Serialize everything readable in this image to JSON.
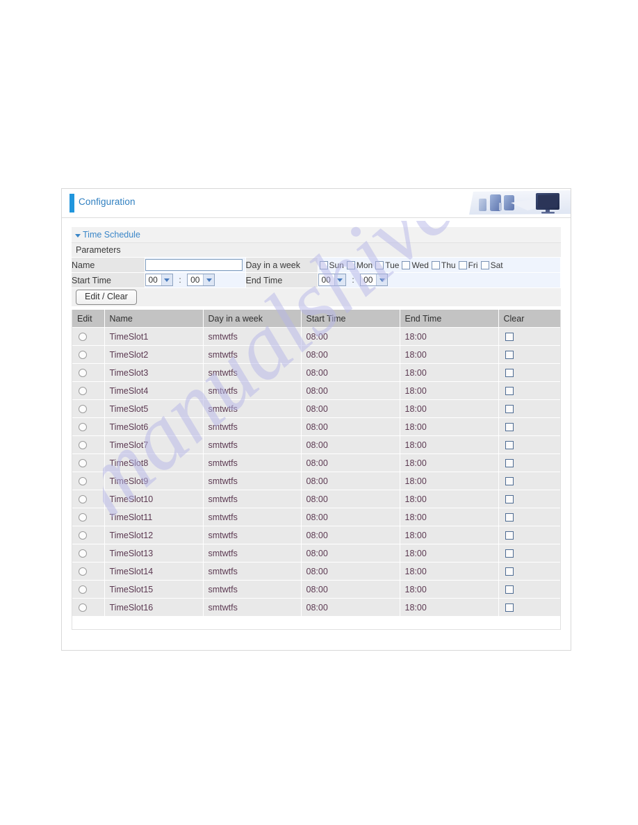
{
  "banner": {
    "title": "Configuration",
    "accent_color": "#2196dd",
    "title_color": "#2f7fc0",
    "art": "office-desk-photo"
  },
  "section": {
    "title": "Time Schedule",
    "expanded": true,
    "marker_color": "#3a86c8"
  },
  "params": {
    "heading": "Parameters",
    "name_label": "Name",
    "name_value": "",
    "name_placeholder": "",
    "day_label": "Day in a week",
    "days": [
      {
        "label": "Sun",
        "checked": false
      },
      {
        "label": "Mon",
        "checked": false
      },
      {
        "label": "Tue",
        "checked": false
      },
      {
        "label": "Wed",
        "checked": false
      },
      {
        "label": "Thu",
        "checked": false
      },
      {
        "label": "Fri",
        "checked": false
      },
      {
        "label": "Sat",
        "checked": false
      }
    ],
    "start_label": "Start Time",
    "start_hour": "00",
    "start_minute": "00",
    "end_label": "End Time",
    "end_hour": "00",
    "end_minute": "00",
    "time_separator": ":",
    "edit_clear_label": "Edit / Clear"
  },
  "table": {
    "columns": [
      "Edit",
      "Name",
      "Day in a week",
      "Start Time",
      "End Time",
      "Clear"
    ],
    "rows": [
      {
        "name": "TimeSlot1",
        "days": "smtwtfs",
        "start": "08:00",
        "end": "18:00",
        "selected": false,
        "clear": false
      },
      {
        "name": "TimeSlot2",
        "days": "smtwtfs",
        "start": "08:00",
        "end": "18:00",
        "selected": false,
        "clear": false
      },
      {
        "name": "TimeSlot3",
        "days": "smtwtfs",
        "start": "08:00",
        "end": "18:00",
        "selected": false,
        "clear": false
      },
      {
        "name": "TimeSlot4",
        "days": "smtwtfs",
        "start": "08:00",
        "end": "18:00",
        "selected": false,
        "clear": false
      },
      {
        "name": "TimeSlot5",
        "days": "smtwtfs",
        "start": "08:00",
        "end": "18:00",
        "selected": false,
        "clear": false
      },
      {
        "name": "TimeSlot6",
        "days": "smtwtfs",
        "start": "08:00",
        "end": "18:00",
        "selected": false,
        "clear": false
      },
      {
        "name": "TimeSlot7",
        "days": "smtwtfs",
        "start": "08:00",
        "end": "18:00",
        "selected": false,
        "clear": false
      },
      {
        "name": "TimeSlot8",
        "days": "smtwtfs",
        "start": "08:00",
        "end": "18:00",
        "selected": false,
        "clear": false
      },
      {
        "name": "TimeSlot9",
        "days": "smtwtfs",
        "start": "08:00",
        "end": "18:00",
        "selected": false,
        "clear": false
      },
      {
        "name": "TimeSlot10",
        "days": "smtwtfs",
        "start": "08:00",
        "end": "18:00",
        "selected": false,
        "clear": false
      },
      {
        "name": "TimeSlot11",
        "days": "smtwtfs",
        "start": "08:00",
        "end": "18:00",
        "selected": false,
        "clear": false
      },
      {
        "name": "TimeSlot12",
        "days": "smtwtfs",
        "start": "08:00",
        "end": "18:00",
        "selected": false,
        "clear": false
      },
      {
        "name": "TimeSlot13",
        "days": "smtwtfs",
        "start": "08:00",
        "end": "18:00",
        "selected": false,
        "clear": false
      },
      {
        "name": "TimeSlot14",
        "days": "smtwtfs",
        "start": "08:00",
        "end": "18:00",
        "selected": false,
        "clear": false
      },
      {
        "name": "TimeSlot15",
        "days": "smtwtfs",
        "start": "08:00",
        "end": "18:00",
        "selected": false,
        "clear": false
      },
      {
        "name": "TimeSlot16",
        "days": "smtwtfs",
        "start": "08:00",
        "end": "18:00",
        "selected": false,
        "clear": false
      }
    ]
  },
  "watermark": {
    "text": "manualshive.com",
    "color": "#b6b6e8"
  }
}
